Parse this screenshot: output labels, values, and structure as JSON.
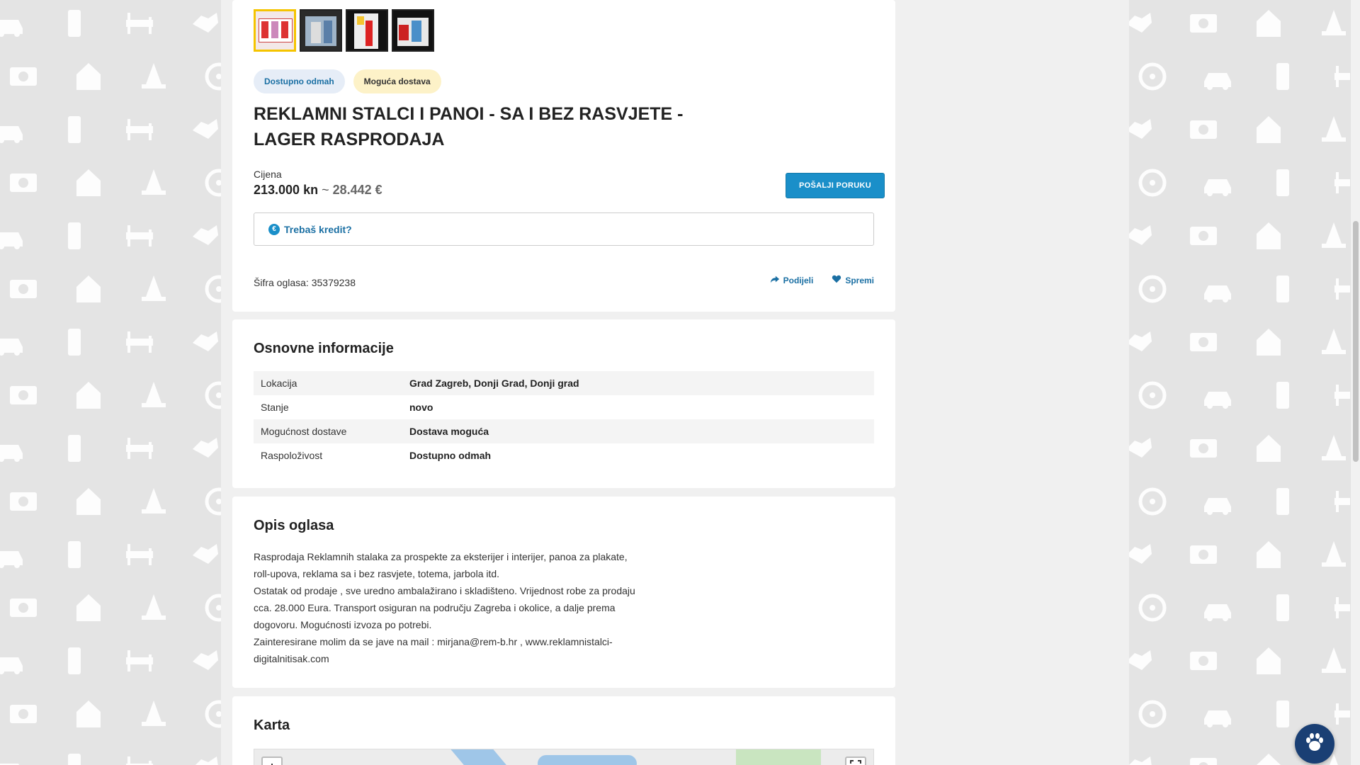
{
  "listing": {
    "badges": [
      "Dostupno odmah",
      "Moguća dostava"
    ],
    "title": "REKLAMNI STALCI I PANOI - SA I BEZ RASVJETE - LAGER RASPRODAJA",
    "price_label": "Cijena",
    "price_kn": "213.000 kn",
    "price_sep": "~",
    "price_eur": "28.442 €",
    "send_message_label": "POŠALJI PORUKU",
    "credit_label": "Trebaš kredit?",
    "ad_code": "Šifra oglasa: 35379238",
    "share_label": "Podijeli",
    "save_label": "Spremi"
  },
  "info": {
    "title": "Osnovne informacije",
    "rows": [
      {
        "key": "Lokacija",
        "value": "Grad Zagreb, Donji Grad, Donji grad"
      },
      {
        "key": "Stanje",
        "value": "novo"
      },
      {
        "key": "Mogućnost dostave",
        "value": "Dostava moguća"
      },
      {
        "key": "Raspoloživost",
        "value": "Dostupno odmah"
      }
    ]
  },
  "description": {
    "title": "Opis oglasa",
    "lines": [
      "Rasprodaja Reklamnih stalaka za prospekte za eksterijer i interijer, panoa za plakate,",
      "roll-upova, reklama sa i bez rasvjete, totema, jarbola itd.",
      "Ostatak od prodaje , sve uredno ambalažirano i skladišteno. Vrijednost robe za prodaju",
      "cca. 28.000 Eura. Transport osiguran na području Zagreba i okolice, a dalje prema",
      "dogovoru. Mogućnosti izvoza po potrebi.",
      "Zainteresirane molim da se jave na mail : mirjana@rem-b.hr , www.reklamnistalci-",
      "digitalnitisak.com"
    ]
  },
  "map": {
    "title": "Karta",
    "zoom_in_label": "+"
  },
  "icons": {
    "credit": "euro-icon",
    "share": "share-arrow-icon",
    "save": "heart-icon",
    "fullscreen": "fullscreen-icon",
    "chat": "paw-icon"
  },
  "colors": {
    "accent": "#1a8fc9",
    "link": "#1a6fa3",
    "active_thumb": "#f5c400",
    "chat_fab": "#1a3f74"
  }
}
